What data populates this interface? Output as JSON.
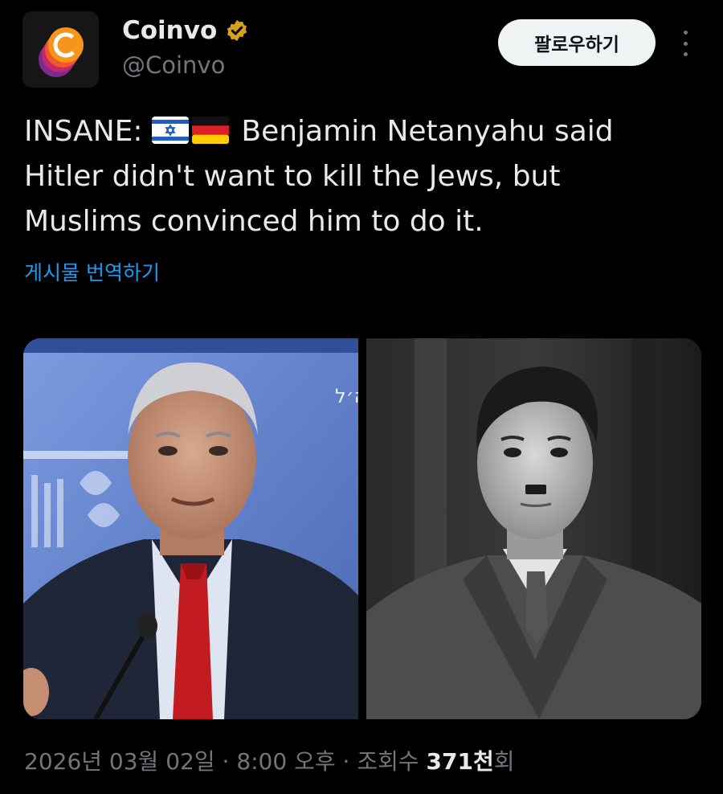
{
  "author": {
    "display_name": "Coinvo",
    "handle": "@Coinvo",
    "avatar_letter": "C",
    "verified_badge": "verified-badge-gold"
  },
  "header": {
    "follow_label": "팔로우하기",
    "more_icon": "more-vertical-icon"
  },
  "tweet": {
    "lines": [
      {
        "prefix": "INSANE: ",
        "flags": [
          "israel-flag",
          "germany-flag"
        ],
        "text": " Benjamin Netanyahu said"
      },
      {
        "text": "Hitler didn't want to kill the Jews, but"
      },
      {
        "text": "Muslims convinced him to do it."
      }
    ],
    "translate_label": "게시물 번역하기"
  },
  "media": {
    "left_image": "photo-netanyahu-at-podium",
    "right_image": "photo-hitler-black-and-white",
    "left_sign_text": "ה׳ל"
  },
  "meta": {
    "date": "2026년 03월 02일",
    "separator1": " · ",
    "time": "8:00 오후",
    "separator2": " · ",
    "views_label": "조회수 ",
    "views_count": "371천",
    "views_suffix": "회"
  },
  "colors": {
    "background": "#000000",
    "text": "#e7e9ea",
    "secondary": "#71767b",
    "link": "#1d9bf0",
    "follow_bg": "#eff3f4",
    "verified": "#d6a21e"
  }
}
